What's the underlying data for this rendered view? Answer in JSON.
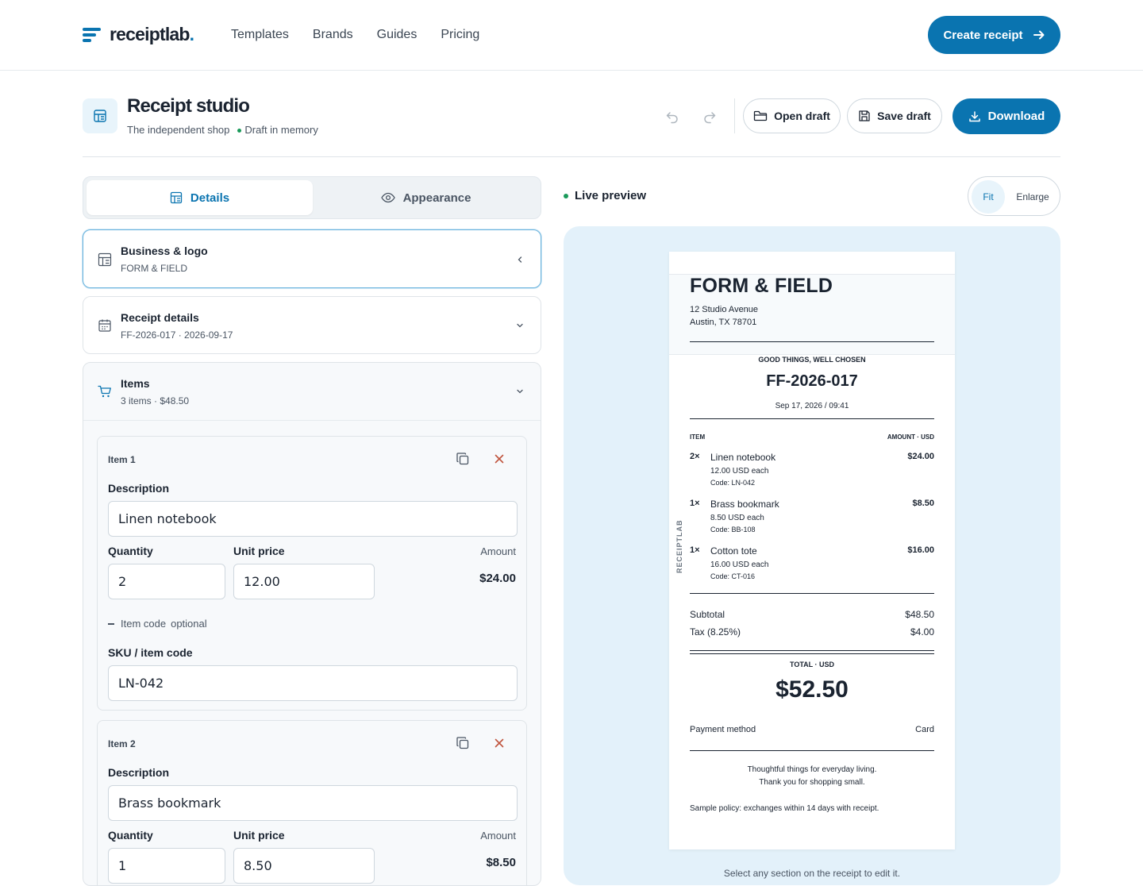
{
  "nav": {
    "brand": "receiptlab",
    "brand_dot": ".",
    "links": [
      "Templates",
      "Brands",
      "Guides",
      "Pricing"
    ],
    "cta": "Create receipt"
  },
  "header": {
    "title": "Receipt studio",
    "shop": "The independent shop",
    "status": "Draft in memory",
    "open_draft": "Open draft",
    "save_draft": "Save draft",
    "download": "Download"
  },
  "tabs": {
    "details": "Details",
    "appearance": "Appearance"
  },
  "sections": {
    "business": {
      "title": "Business & logo",
      "sub": "FORM & FIELD"
    },
    "details": {
      "title": "Receipt details",
      "sub": "FF-2026-017 · 2026-09-17"
    },
    "items": {
      "title": "Items",
      "sub": "3 items · $48.50"
    }
  },
  "items": [
    {
      "label": "Item 1",
      "description_label": "Description",
      "description": "Linen notebook",
      "quantity_label": "Quantity",
      "quantity": "2",
      "price_label": "Unit price",
      "price": "12.00",
      "amount_label": "Amount",
      "amount": "$24.00",
      "code_toggle": "Item code",
      "code_optional": "optional",
      "sku_label": "SKU / item code",
      "sku": "LN-042"
    },
    {
      "label": "Item 2",
      "description_label": "Description",
      "description": "Brass bookmark",
      "quantity_label": "Quantity",
      "quantity": "1",
      "price_label": "Unit price",
      "price": "8.50",
      "amount_label": "Amount",
      "amount": "$8.50"
    }
  ],
  "preview": {
    "label": "Live preview",
    "fit": "Fit",
    "enlarge": "Enlarge",
    "hint": "Select any section on the receipt to edit it."
  },
  "receipt": {
    "business": "FORM & FIELD",
    "address1": "12 Studio Avenue",
    "address2": "Austin, TX 78701",
    "tagline": "GOOD THINGS, WELL CHOSEN",
    "number": "FF-2026-017",
    "datetime": "Sep 17, 2026 / 09:41",
    "col_item": "ITEM",
    "col_amount": "AMOUNT · USD",
    "side_label": "RECEIPTLAB",
    "lines": [
      {
        "qty": "2×",
        "name": "Linen notebook",
        "each": "12.00 USD each",
        "code": "Code: LN-042",
        "amount": "$24.00"
      },
      {
        "qty": "1×",
        "name": "Brass bookmark",
        "each": "8.50 USD each",
        "code": "Code: BB-108",
        "amount": "$8.50"
      },
      {
        "qty": "1×",
        "name": "Cotton tote",
        "each": "16.00 USD each",
        "code": "Code: CT-016",
        "amount": "$16.00"
      }
    ],
    "subtotal_label": "Subtotal",
    "subtotal": "$48.50",
    "tax_label": "Tax (8.25%)",
    "tax": "$4.00",
    "total_label": "TOTAL · USD",
    "total": "$52.50",
    "payment_label": "Payment method",
    "payment": "Card",
    "footer1": "Thoughtful things for everyday living.",
    "footer2": "Thank you for shopping small.",
    "policy": "Sample policy: exchanges within 14 days with receipt."
  },
  "colors": {
    "accent": "#0a74b0",
    "preview_bg": "#e3f1fa",
    "status_dot": "#1a9a5a",
    "delete": "#c0553e"
  }
}
